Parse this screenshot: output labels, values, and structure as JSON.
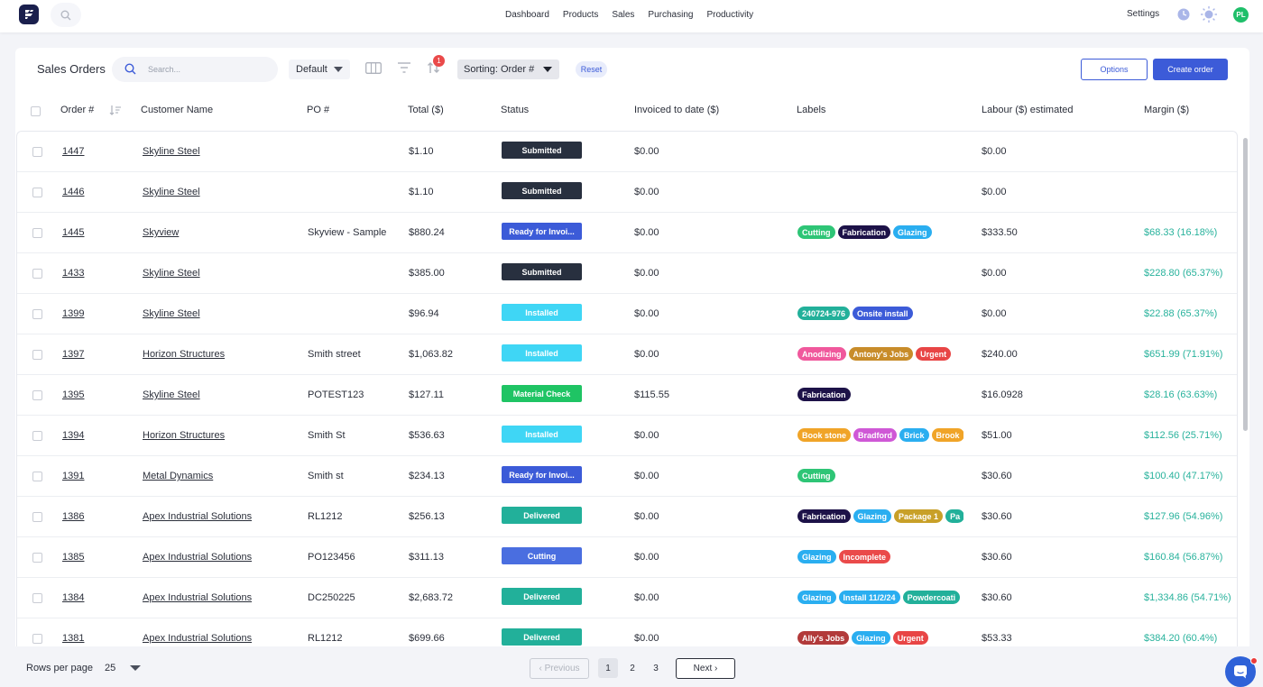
{
  "nav": {
    "links": [
      "Dashboard",
      "Products",
      "Sales",
      "Purchasing",
      "Productivity"
    ],
    "settings": "Settings",
    "avatar_initials": "PL"
  },
  "toolbar": {
    "title": "Sales Orders",
    "search_placeholder": "Search...",
    "view": "Default",
    "sort_badge": "1",
    "sorting": "Sorting: Order #",
    "reset": "Reset",
    "options": "Options",
    "create": "Create order"
  },
  "columns": {
    "order": "Order #",
    "customer": "Customer Name",
    "po": "PO #",
    "total": "Total ($)",
    "status": "Status",
    "invoiced": "Invoiced to date ($)",
    "labels": "Labels",
    "labour": "Labour ($) estimated",
    "margin": "Margin ($)"
  },
  "colors": {
    "accent": "#3c5bd8",
    "margin_text": "#28b29c",
    "status": {
      "Submitted": "#28303f",
      "Ready for Invoi...": "#3c5bd8",
      "Installed": "#3fd6f5",
      "Material Check": "#1fc464",
      "Delivered": "#22b09a",
      "Cutting": "#4a6ee0"
    },
    "labels": {
      "Cutting": "#2ec576",
      "Fabrication": "#1d1248",
      "Glazing": "#2aaef0",
      "240724-976": "#22b09a",
      "Onsite install": "#3c5bd8",
      "Anodizing": "#f0589c",
      "Antony's Jobs": "#c88c2a",
      "Urgent": "#e84545",
      "Book stone": "#f0a428",
      "Bradford": "#cf58d6",
      "Brick": "#2aaef0",
      "Brook": "#f0a428",
      "Package 1": "#c8a028",
      "Pa": "#22b09a",
      "Incomplete": "#ea4a4a",
      "Install 11/2/24": "#2aaef0",
      "Powdercoati": "#22b09a",
      "Ally's Jobs": "#b23a3a"
    }
  },
  "rows": [
    {
      "order": "1447",
      "customer": "Skyline Steel",
      "po": "",
      "total": "$1.10",
      "status": "Submitted",
      "invoiced": "$0.00",
      "labels": [],
      "labour": "$0.00",
      "margin": ""
    },
    {
      "order": "1446",
      "customer": "Skyline Steel",
      "po": "",
      "total": "$1.10",
      "status": "Submitted",
      "invoiced": "$0.00",
      "labels": [],
      "labour": "$0.00",
      "margin": ""
    },
    {
      "order": "1445",
      "customer": "Skyview",
      "po": "Skyview - Sample",
      "total": "$880.24",
      "status": "Ready for Invoi...",
      "invoiced": "$0.00",
      "labels": [
        "Cutting",
        "Fabrication",
        "Glazing"
      ],
      "labour": "$333.50",
      "margin": "$68.33 (16.18%)"
    },
    {
      "order": "1433",
      "customer": "Skyline Steel",
      "po": "",
      "total": "$385.00",
      "status": "Submitted",
      "invoiced": "$0.00",
      "labels": [],
      "labour": "$0.00",
      "margin": "$228.80 (65.37%)"
    },
    {
      "order": "1399",
      "customer": "Skyline Steel",
      "po": "",
      "total": "$96.94",
      "status": "Installed",
      "invoiced": "$0.00",
      "labels": [
        "240724-976",
        "Onsite install"
      ],
      "labour": "$0.00",
      "margin": "$22.88 (65.37%)"
    },
    {
      "order": "1397",
      "customer": "Horizon Structures",
      "po": "Smith street",
      "total": "$1,063.82",
      "status": "Installed",
      "invoiced": "$0.00",
      "labels": [
        "Anodizing",
        "Antony's Jobs",
        "Urgent"
      ],
      "labour": "$240.00",
      "margin": "$651.99 (71.91%)"
    },
    {
      "order": "1395",
      "customer": "Skyline Steel",
      "po": "POTEST123",
      "total": "$127.11",
      "status": "Material Check",
      "invoiced": "$115.55",
      "labels": [
        "Fabrication"
      ],
      "labour": "$16.0928",
      "margin": "$28.16 (63.63%)"
    },
    {
      "order": "1394",
      "customer": "Horizon Structures",
      "po": "Smith St",
      "total": "$536.63",
      "status": "Installed",
      "invoiced": "$0.00",
      "labels": [
        "Book stone",
        "Bradford",
        "Brick",
        "Brook"
      ],
      "labour": "$51.00",
      "margin": "$112.56 (25.71%)"
    },
    {
      "order": "1391",
      "customer": "Metal Dynamics",
      "po": "Smith st",
      "total": "$234.13",
      "status": "Ready for Invoi...",
      "invoiced": "$0.00",
      "labels": [
        "Cutting"
      ],
      "labour": "$30.60",
      "margin": "$100.40 (47.17%)"
    },
    {
      "order": "1386",
      "customer": "Apex Industrial Solutions",
      "po": "RL1212",
      "total": "$256.13",
      "status": "Delivered",
      "invoiced": "$0.00",
      "labels": [
        "Fabrication",
        "Glazing",
        "Package 1",
        "Pa"
      ],
      "labour": "$30.60",
      "margin": "$127.96 (54.96%)"
    },
    {
      "order": "1385",
      "customer": "Apex Industrial Solutions",
      "po": "PO123456",
      "total": "$311.13",
      "status": "Cutting",
      "invoiced": "$0.00",
      "labels": [
        "Glazing",
        "Incomplete"
      ],
      "labour": "$30.60",
      "margin": "$160.84 (56.87%)"
    },
    {
      "order": "1384",
      "customer": "Apex Industrial Solutions",
      "po": "DC250225",
      "total": "$2,683.72",
      "status": "Delivered",
      "invoiced": "$0.00",
      "labels": [
        "Glazing",
        "Install 11/2/24",
        "Powdercoati"
      ],
      "labour": "$30.60",
      "margin": "$1,334.86 (54.71%)"
    },
    {
      "order": "1381",
      "customer": "Apex Industrial Solutions",
      "po": "RL1212",
      "total": "$699.66",
      "status": "Delivered",
      "invoiced": "$0.00",
      "labels": [
        "Ally's Jobs",
        "Glazing",
        "Urgent"
      ],
      "labour": "$53.33",
      "margin": "$384.20 (60.4%)"
    }
  ],
  "footer": {
    "rows_per_page_label": "Rows per page",
    "rows_per_page": "25",
    "previous": "Previous",
    "pages": [
      "1",
      "2",
      "3"
    ],
    "current_page": "1",
    "next": "Next"
  }
}
